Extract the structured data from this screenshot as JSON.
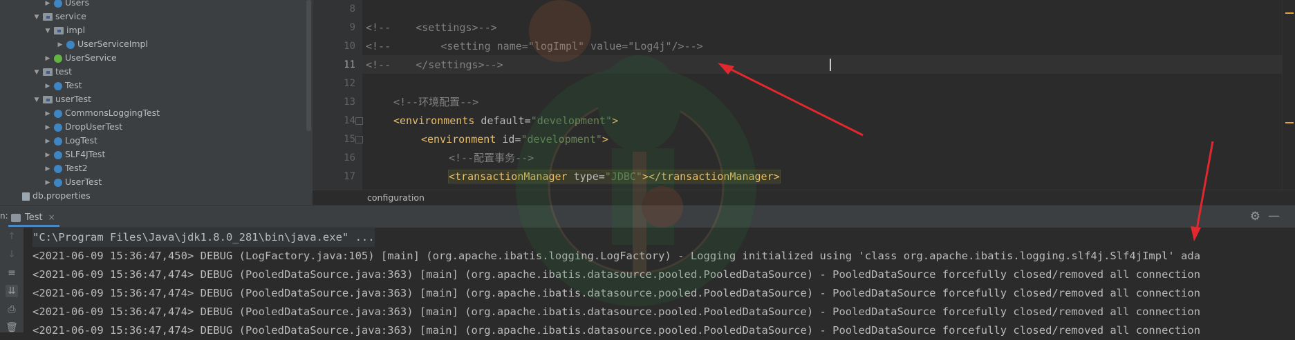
{
  "project_tree": {
    "items": [
      {
        "label": "Users",
        "kind": "class",
        "depth": 5,
        "arrow": "collapsed"
      },
      {
        "label": "service",
        "kind": "folder",
        "depth": 3,
        "arrow": "expanded"
      },
      {
        "label": "impl",
        "kind": "folder",
        "depth": 4,
        "arrow": "expanded"
      },
      {
        "label": "UserServiceImpl",
        "kind": "class",
        "depth": 5,
        "arrow": "collapsed"
      },
      {
        "label": "UserService",
        "kind": "interface",
        "depth": 4,
        "arrow": "collapsed"
      },
      {
        "label": "test",
        "kind": "folder",
        "depth": 3,
        "arrow": "expanded"
      },
      {
        "label": "Test",
        "kind": "class",
        "depth": 4,
        "arrow": "collapsed"
      },
      {
        "label": "userTest",
        "kind": "folder",
        "depth": 3,
        "arrow": "expanded"
      },
      {
        "label": "CommonsLoggingTest",
        "kind": "class",
        "depth": 4,
        "arrow": "collapsed"
      },
      {
        "label": "DropUserTest",
        "kind": "class",
        "depth": 4,
        "arrow": "collapsed"
      },
      {
        "label": "LogTest",
        "kind": "class",
        "depth": 4,
        "arrow": "collapsed"
      },
      {
        "label": "SLF4JTest",
        "kind": "class",
        "depth": 4,
        "arrow": "collapsed"
      },
      {
        "label": "Test2",
        "kind": "class",
        "depth": 4,
        "arrow": "collapsed"
      },
      {
        "label": "UserTest",
        "kind": "class",
        "depth": 4,
        "arrow": "collapsed"
      },
      {
        "label": "db.properties",
        "kind": "properties",
        "depth": 2,
        "arrow": "none"
      }
    ]
  },
  "editor": {
    "line_numbers": [
      "8",
      "9",
      "10",
      "11",
      "12",
      "13",
      "14",
      "15",
      "16",
      "17"
    ],
    "current_line": "11",
    "code": {
      "l9": {
        "comment": "<!--    <settings>-->"
      },
      "l10": {
        "comment": "<!--        <setting name=\"logImpl\" value=\"Log4j\"/>-->"
      },
      "l11": {
        "comment": "<!--    </settings>-->"
      },
      "l13": {
        "comment": "<!--环境配置-->"
      },
      "l14": {
        "tag_open": "<environments",
        "attr": " default=",
        "value": "\"development\"",
        "tag_close": ">"
      },
      "l15": {
        "tag_open": "<environment",
        "attr": " id=",
        "value": "\"development\"",
        "tag_close": ">"
      },
      "l16": {
        "comment": "<!--配置事务-->"
      },
      "l17": {
        "tag_open": "<transactionManager",
        "attr": " type=",
        "value": "\"JDBC\"",
        "tag_close": "></transactionManager>"
      }
    },
    "breadcrumb": "configuration"
  },
  "run_panel": {
    "prefix": "n:",
    "tab_label": "Test",
    "tab_close": "×",
    "console_lines": [
      "\"C:\\Program Files\\Java\\jdk1.8.0_281\\bin\\java.exe\" ...",
      "<2021-06-09 15:36:47,450> DEBUG (LogFactory.java:105) [main] (org.apache.ibatis.logging.LogFactory) - Logging initialized using 'class org.apache.ibatis.logging.slf4j.Slf4jImpl' ada",
      "<2021-06-09 15:36:47,474> DEBUG (PooledDataSource.java:363) [main] (org.apache.ibatis.datasource.pooled.PooledDataSource) - PooledDataSource forcefully closed/removed all connection",
      "<2021-06-09 15:36:47,474> DEBUG (PooledDataSource.java:363) [main] (org.apache.ibatis.datasource.pooled.PooledDataSource) - PooledDataSource forcefully closed/removed all connection",
      "<2021-06-09 15:36:47,474> DEBUG (PooledDataSource.java:363) [main] (org.apache.ibatis.datasource.pooled.PooledDataSource) - PooledDataSource forcefully closed/removed all connection",
      "<2021-06-09 15:36:47,474> DEBUG (PooledDataSource.java:363) [main] (org.apache.ibatis.datasource.pooled.PooledDataSource) - PooledDataSource forcefully closed/removed all connection"
    ],
    "toolbar_icons": [
      "arrow-up-icon",
      "arrow-down-icon",
      "soft-wrap-icon",
      "scroll-to-end-icon",
      "print-icon",
      "trash-icon"
    ]
  },
  "colors": {
    "annotation_arrow": "#e0282e",
    "watermark_green": "#1f7a3a",
    "watermark_gold": "#b9975b",
    "accent_blue": "#4a88c7"
  }
}
